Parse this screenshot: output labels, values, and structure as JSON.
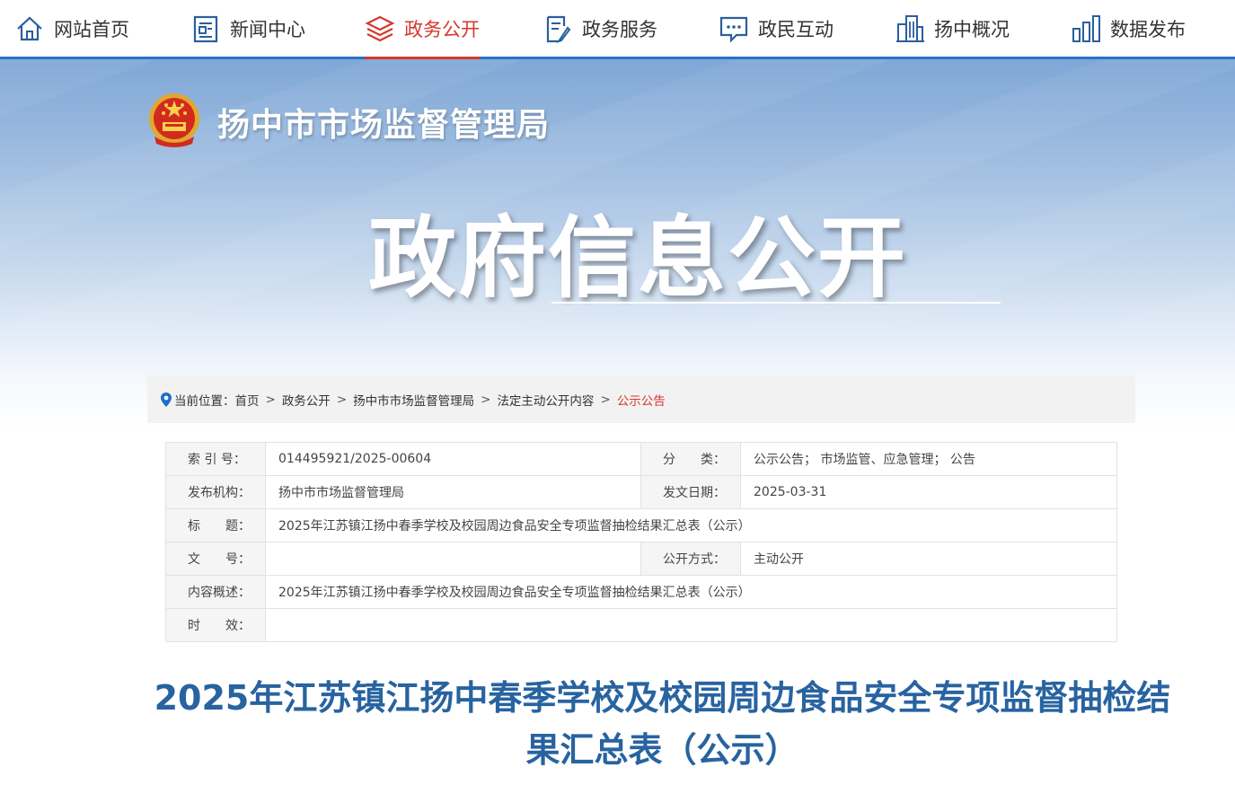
{
  "nav": {
    "items": [
      {
        "label": "网站首页",
        "icon": "home-icon"
      },
      {
        "label": "新闻中心",
        "icon": "news-icon"
      },
      {
        "label": "政务公开",
        "icon": "layers-icon",
        "active": true
      },
      {
        "label": "政务服务",
        "icon": "document-pen-icon"
      },
      {
        "label": "政民互动",
        "icon": "chat-icon"
      },
      {
        "label": "扬中概况",
        "icon": "buildings-icon"
      },
      {
        "label": "数据发布",
        "icon": "bar-chart-icon"
      }
    ],
    "active_color": "#d6382e"
  },
  "banner": {
    "org_name": "扬中市市场监督管理局",
    "title": "政府信息公开"
  },
  "breadcrumb": {
    "prefix": "当前位置：",
    "items": [
      "首页",
      "政务公开",
      "扬中市市场监督管理局",
      "法定主动公开内容",
      "公示公告"
    ],
    "separator": ">"
  },
  "info": {
    "index_label": "索 引 号：",
    "index_value": "014495921/2025-00604",
    "category_label": "分　　类：",
    "category_value": "公示公告； 市场监管、应急管理； 公告",
    "publisher_label": "发布机构：",
    "publisher_value": "扬中市市场监督管理局",
    "date_label": "发文日期：",
    "date_value": "2025-03-31",
    "title_label": "标　　题：",
    "title_value": "2025年江苏镇江扬中春季学校及校园周边食品安全专项监督抽检结果汇总表（公示）",
    "docno_label": "文　　号：",
    "docno_value": "",
    "method_label": "公开方式：",
    "method_value": "主动公开",
    "summary_label": "内容概述：",
    "summary_value": "2025年江苏镇江扬中春季学校及校园周边食品安全专项监督抽检结果汇总表（公示）",
    "validity_label": "时　　效：",
    "validity_value": ""
  },
  "article": {
    "title": "2025年江苏镇江扬中春季学校及校园周边食品安全专项监督抽检结果汇总表（公示）"
  }
}
